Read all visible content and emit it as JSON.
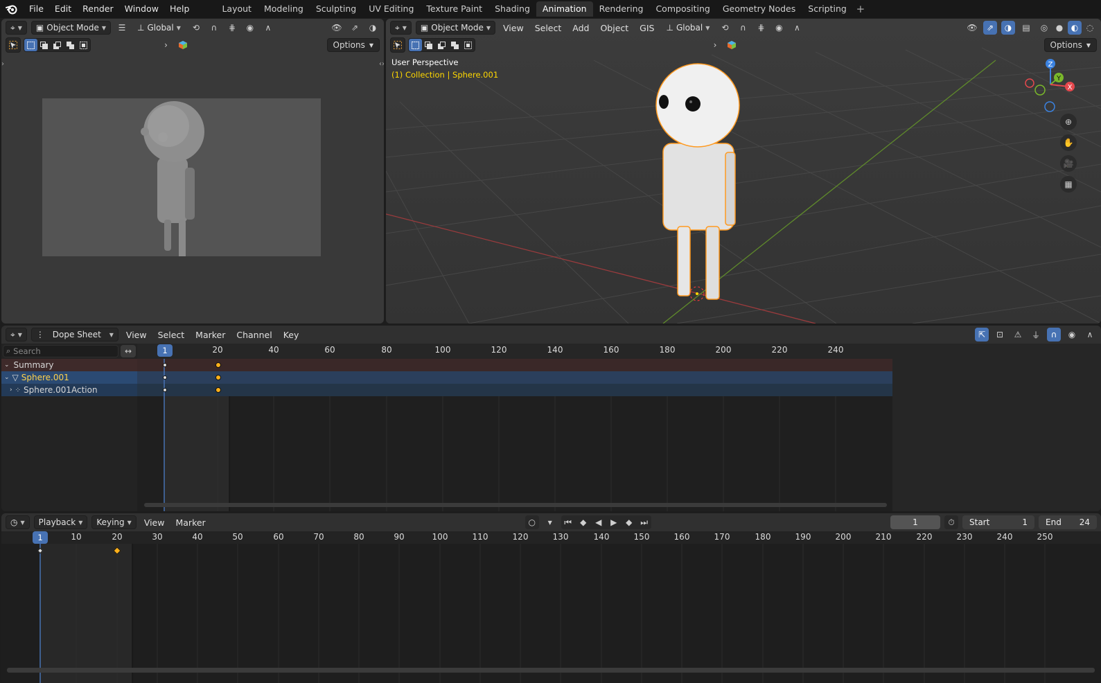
{
  "menubar": {
    "items": [
      "File",
      "Edit",
      "Render",
      "Window",
      "Help"
    ]
  },
  "workspaces": {
    "tabs": [
      "Layout",
      "Modeling",
      "Sculpting",
      "UV Editing",
      "Texture Paint",
      "Shading",
      "Animation",
      "Rendering",
      "Compositing",
      "Geometry Nodes",
      "Scripting"
    ],
    "active": "Animation",
    "add_label": "+"
  },
  "left_viewport": {
    "mode": "Object Mode",
    "orientation": "Global",
    "options_label": "Options"
  },
  "right_viewport": {
    "mode": "Object Mode",
    "menus": [
      "View",
      "Select",
      "Add",
      "Object",
      "GIS"
    ],
    "orientation": "Global",
    "options_label": "Options",
    "overlay_title": "User Perspective",
    "overlay_collection": "(1) Collection | Sphere.001",
    "gizmo_axes": [
      "Z",
      "Y",
      "X"
    ]
  },
  "dopesheet": {
    "editor_type": "Dope Sheet",
    "menus": [
      "View",
      "Select",
      "Marker",
      "Channel",
      "Key"
    ],
    "search_placeholder": "Search",
    "current_frame": "1",
    "ruler": [
      "20",
      "40",
      "60",
      "80",
      "100",
      "120",
      "140",
      "160",
      "180",
      "200",
      "220",
      "240"
    ],
    "channels": [
      {
        "label": "Summary",
        "type": "summary"
      },
      {
        "label": "Sphere.001",
        "type": "object"
      },
      {
        "label": "Sphere.001Action",
        "type": "action"
      }
    ]
  },
  "timeline": {
    "menus": [
      "Playback",
      "Keying",
      "View",
      "Marker"
    ],
    "current_frame": "1",
    "start_label": "Start",
    "start_value": "1",
    "end_label": "End",
    "end_value": "24",
    "frame_field": "1",
    "ruler": [
      "10",
      "20",
      "30",
      "40",
      "50",
      "60",
      "70",
      "80",
      "90",
      "100",
      "110",
      "120",
      "130",
      "140",
      "150",
      "160",
      "170",
      "180",
      "190",
      "200",
      "210",
      "220",
      "230",
      "240",
      "250"
    ]
  },
  "colors": {
    "accent": "#4772b3",
    "keyframe": "#ffb11b",
    "selection_outline": "#ff9a20",
    "x_axis": "#e5484d",
    "y_axis": "#7ab82b",
    "z_axis": "#3b82e0"
  }
}
